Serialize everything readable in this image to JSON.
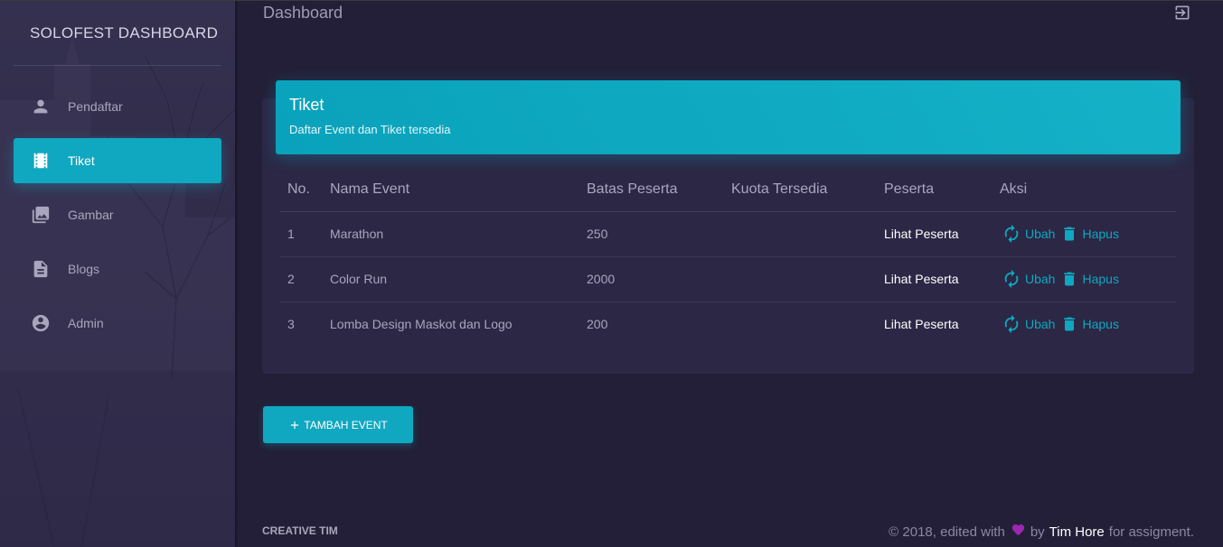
{
  "header": {
    "page_title": "Dashboard",
    "logout_icon": "logout-icon"
  },
  "sidebar": {
    "brand": "SOLOFEST DASHBOARD",
    "items": [
      {
        "label": "Pendaftar",
        "icon": "person-icon",
        "active": false
      },
      {
        "label": "Tiket",
        "icon": "movie-film-icon",
        "active": true
      },
      {
        "label": "Gambar",
        "icon": "photo-library-icon",
        "active": false
      },
      {
        "label": "Blogs",
        "icon": "document-icon",
        "active": false
      },
      {
        "label": "Admin",
        "icon": "account-circle-icon",
        "active": false
      }
    ]
  },
  "card": {
    "title": "Tiket",
    "subtitle": "Daftar Event dan Tiket tersedia",
    "columns": [
      "No.",
      "Nama Event",
      "Batas Peserta",
      "Kuota Tersedia",
      "Peserta",
      "Aksi"
    ],
    "rows": [
      {
        "no": "1",
        "name": "Marathon",
        "batas": "250",
        "kuota": "",
        "peserta": "Lihat Peserta",
        "edit": "Ubah",
        "delete": "Hapus"
      },
      {
        "no": "2",
        "name": "Color Run",
        "batas": "2000",
        "kuota": "",
        "peserta": "Lihat Peserta",
        "edit": "Ubah",
        "delete": "Hapus"
      },
      {
        "no": "3",
        "name": "Lomba Design Maskot dan Logo",
        "batas": "200",
        "kuota": "",
        "peserta": "Lihat Peserta",
        "edit": "Ubah",
        "delete": "Hapus"
      }
    ]
  },
  "actions": {
    "add_event": "TAMBAH EVENT"
  },
  "footer": {
    "left": "CREATIVE TIM",
    "text_before": "© 2018, edited with",
    "text_by": "by",
    "author": "Tim Hore",
    "text_after": "for assigment."
  },
  "colors": {
    "accent": "#10a7c0",
    "background": "#231f38",
    "card": "#2b2745",
    "heart": "#9c27b0"
  }
}
